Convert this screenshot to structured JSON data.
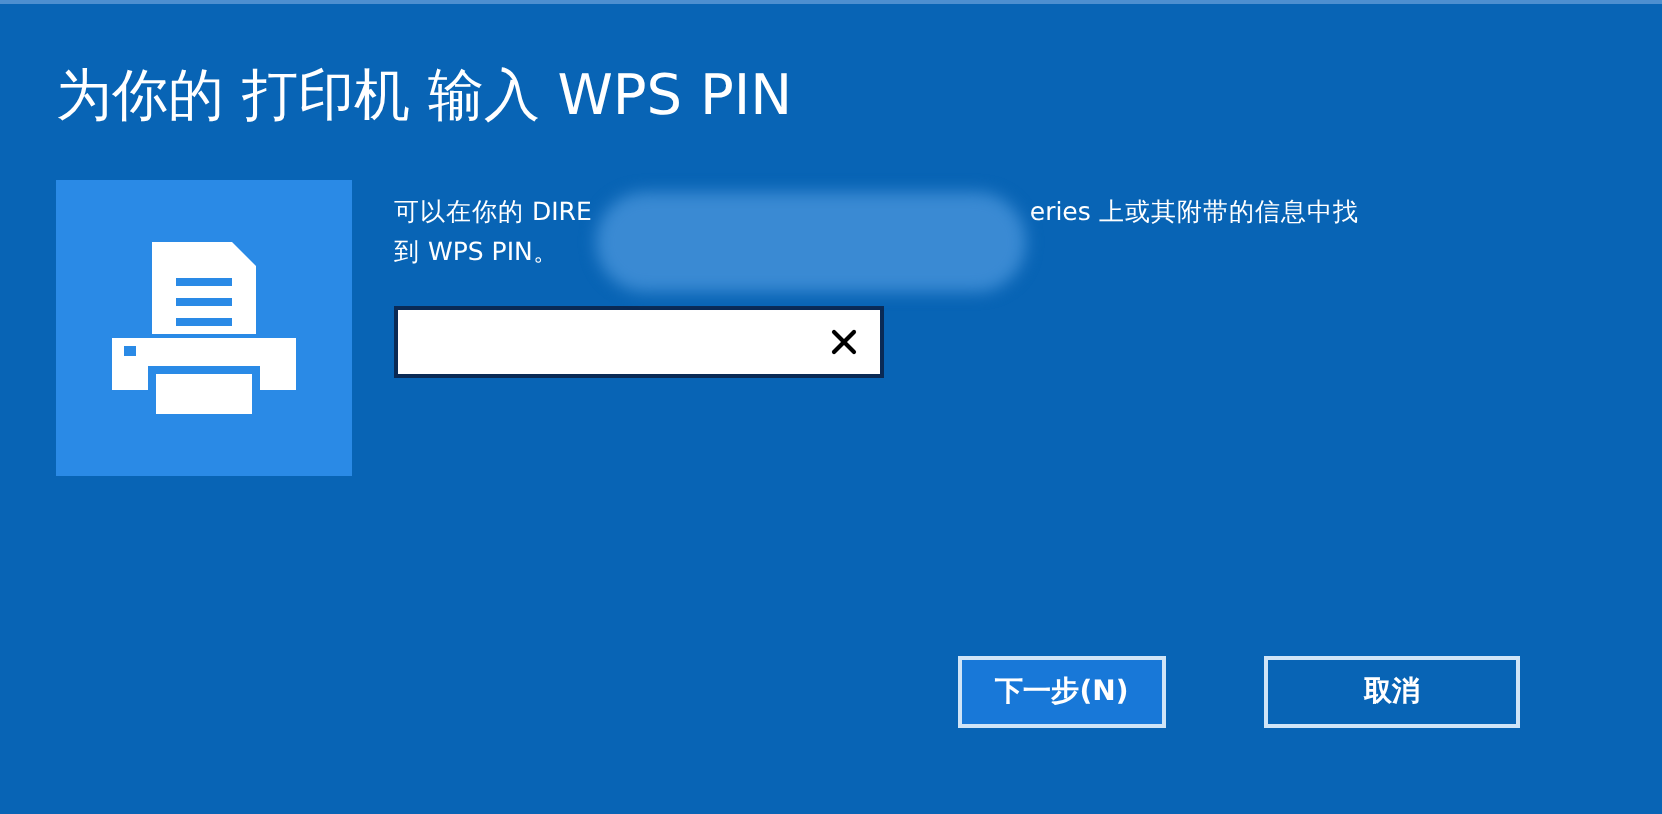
{
  "title": "为你的 打印机 输入 WPS PIN",
  "description": [
    "可以在你的 DIRE",
    "eries 上或其附带的信息中找",
    "到 WPS PIN。"
  ],
  "pin_field": {
    "clear_button": true
  },
  "buttons": [
    {
      "label": "下一步(N)",
      "kind": "primary"
    },
    {
      "label": "取消",
      "kind": "secondary"
    }
  ]
}
